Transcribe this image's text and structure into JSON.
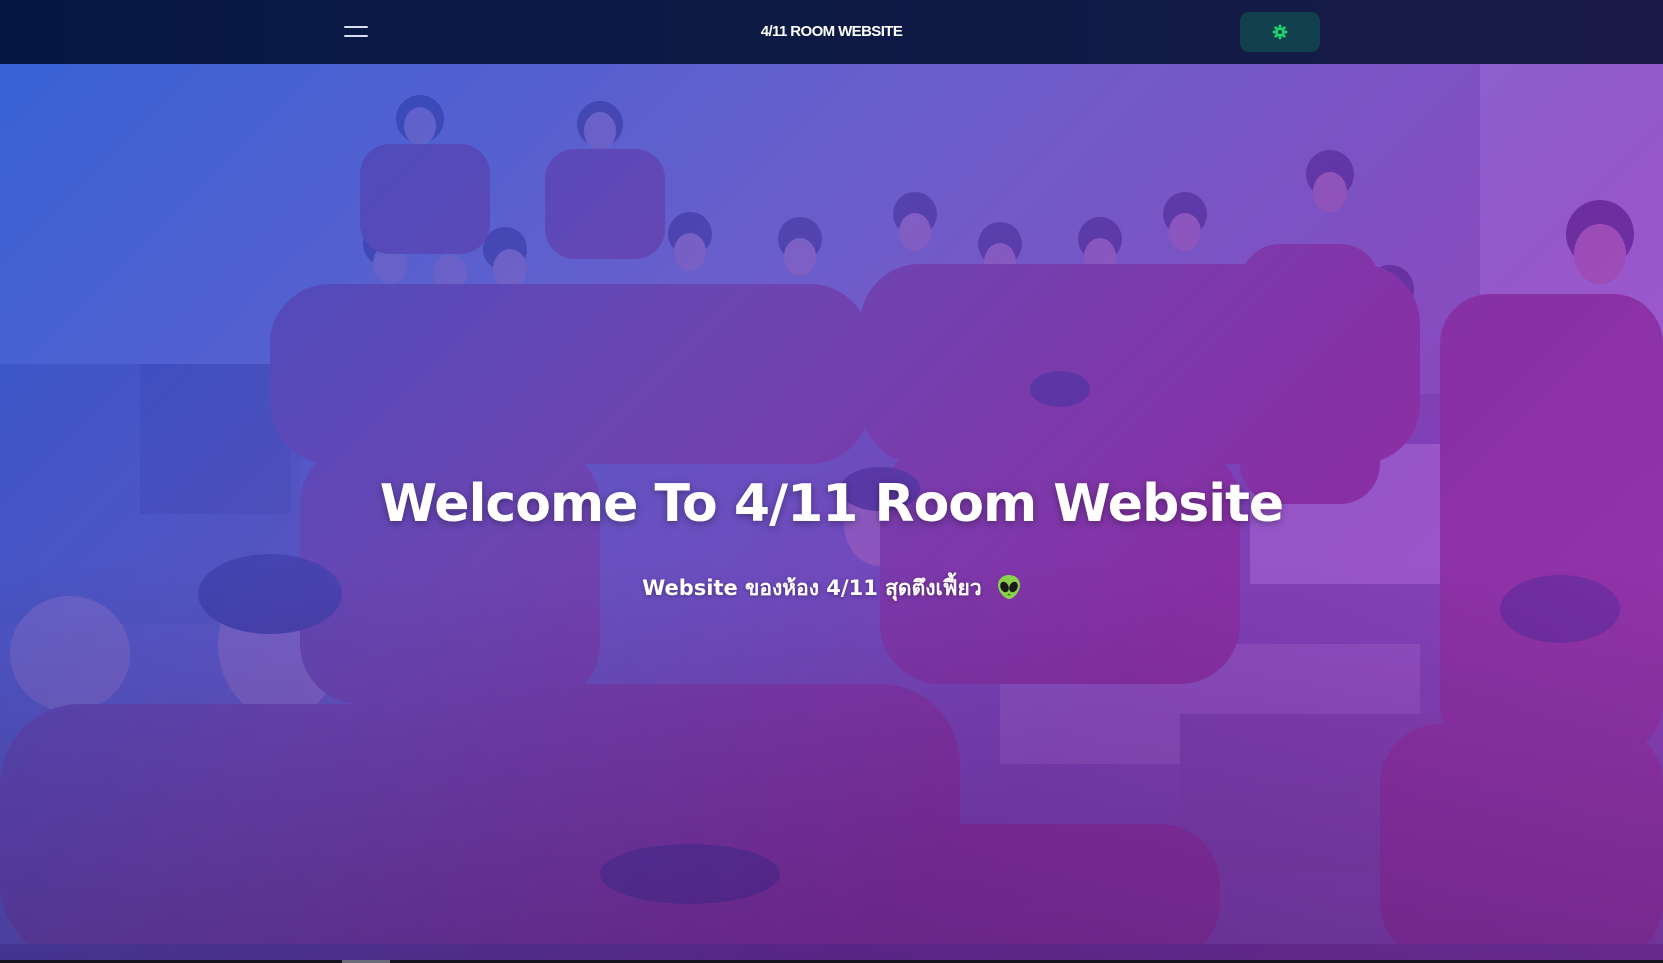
{
  "navbar": {
    "title": "4/11 ROOM WEBSITE",
    "menu_icon": "hamburger-menu-icon",
    "settings_icon": "gear-icon"
  },
  "hero": {
    "heading": "Welcome To 4/11 Room Website",
    "subtitle": "Website ของห้อง 4/11 สุดตึงเฟี้ยว",
    "subtitle_icon": "alien-icon",
    "background_image": "class-group-photo"
  },
  "colors": {
    "navbar_start": "#061842",
    "navbar_end": "#1a1a48",
    "settings_button_bg": "#123f4c",
    "settings_icon": "#1ed36a",
    "overlay_blue": "#235ae6",
    "overlay_purple": "#a03cdc"
  }
}
